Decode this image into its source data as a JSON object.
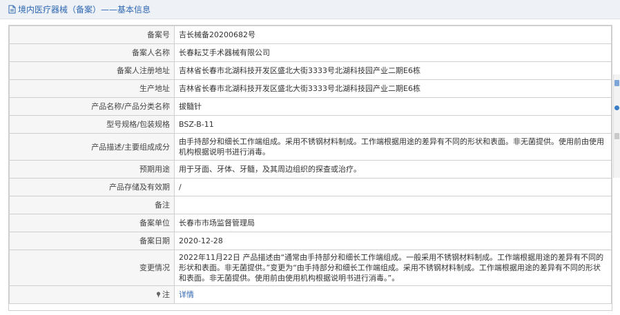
{
  "header": {
    "title": "境内医疗器械（备案）——基本信息"
  },
  "rows": [
    {
      "label": "备案号",
      "value": "吉长械备20200682号"
    },
    {
      "label": "备案人名称",
      "value": "长春耘艾手术器械有限公司"
    },
    {
      "label": "备案人注册地址",
      "value": "吉林省长春市北湖科技开发区盛北大街3333号北湖科技园产业二期E6栋"
    },
    {
      "label": "生产地址",
      "value": "吉林省长春市北湖科技开发区盛北大街3333号北湖科技园产业二期E6栋"
    },
    {
      "label": "产品名称/产品分类名称",
      "value": "拔髓针"
    },
    {
      "label": "型号规格/包装规格",
      "value": "BSZ-B-11"
    },
    {
      "label": "产品描述/主要组成成分",
      "value": "由手持部分和细长工作端组成。采用不锈钢材料制成。工作端根据用途的差异有不同的形状和表面。非无菌提供。使用前由使用机构根据说明书进行消毒。"
    },
    {
      "label": "预期用途",
      "value": "用于牙面、牙体、牙髓，及其周边组织的探查或治疗。"
    },
    {
      "label": "产品存储及有效期",
      "value": "/"
    },
    {
      "label": "备注",
      "value": ""
    },
    {
      "label": "备案单位",
      "value": "长春市市场监督管理局"
    },
    {
      "label": "备案日期",
      "value": "2020-12-28"
    },
    {
      "label": "变更情况",
      "value": "2022年11月22日 产品描述由“通常由手持部分和细长工作端组成。一般采用不锈钢材料制成。工作端根据用途的差异有不同的形状和表面。非无菌提供。”变更为“由手持部分和细长工作端组成。采用不锈钢材料制成。工作端根据用途的差异有不同的形状和表面。非无菌提供。使用前由使用机构根据说明书进行消毒。”。"
    },
    {
      "label": "注",
      "value": "详情"
    }
  ],
  "colors": {
    "accent": "#2f67b1",
    "label_bg": "#f6f6f6",
    "border": "#cfcfcf"
  },
  "icons": {
    "title": "document-icon",
    "note": "pin-icon"
  }
}
